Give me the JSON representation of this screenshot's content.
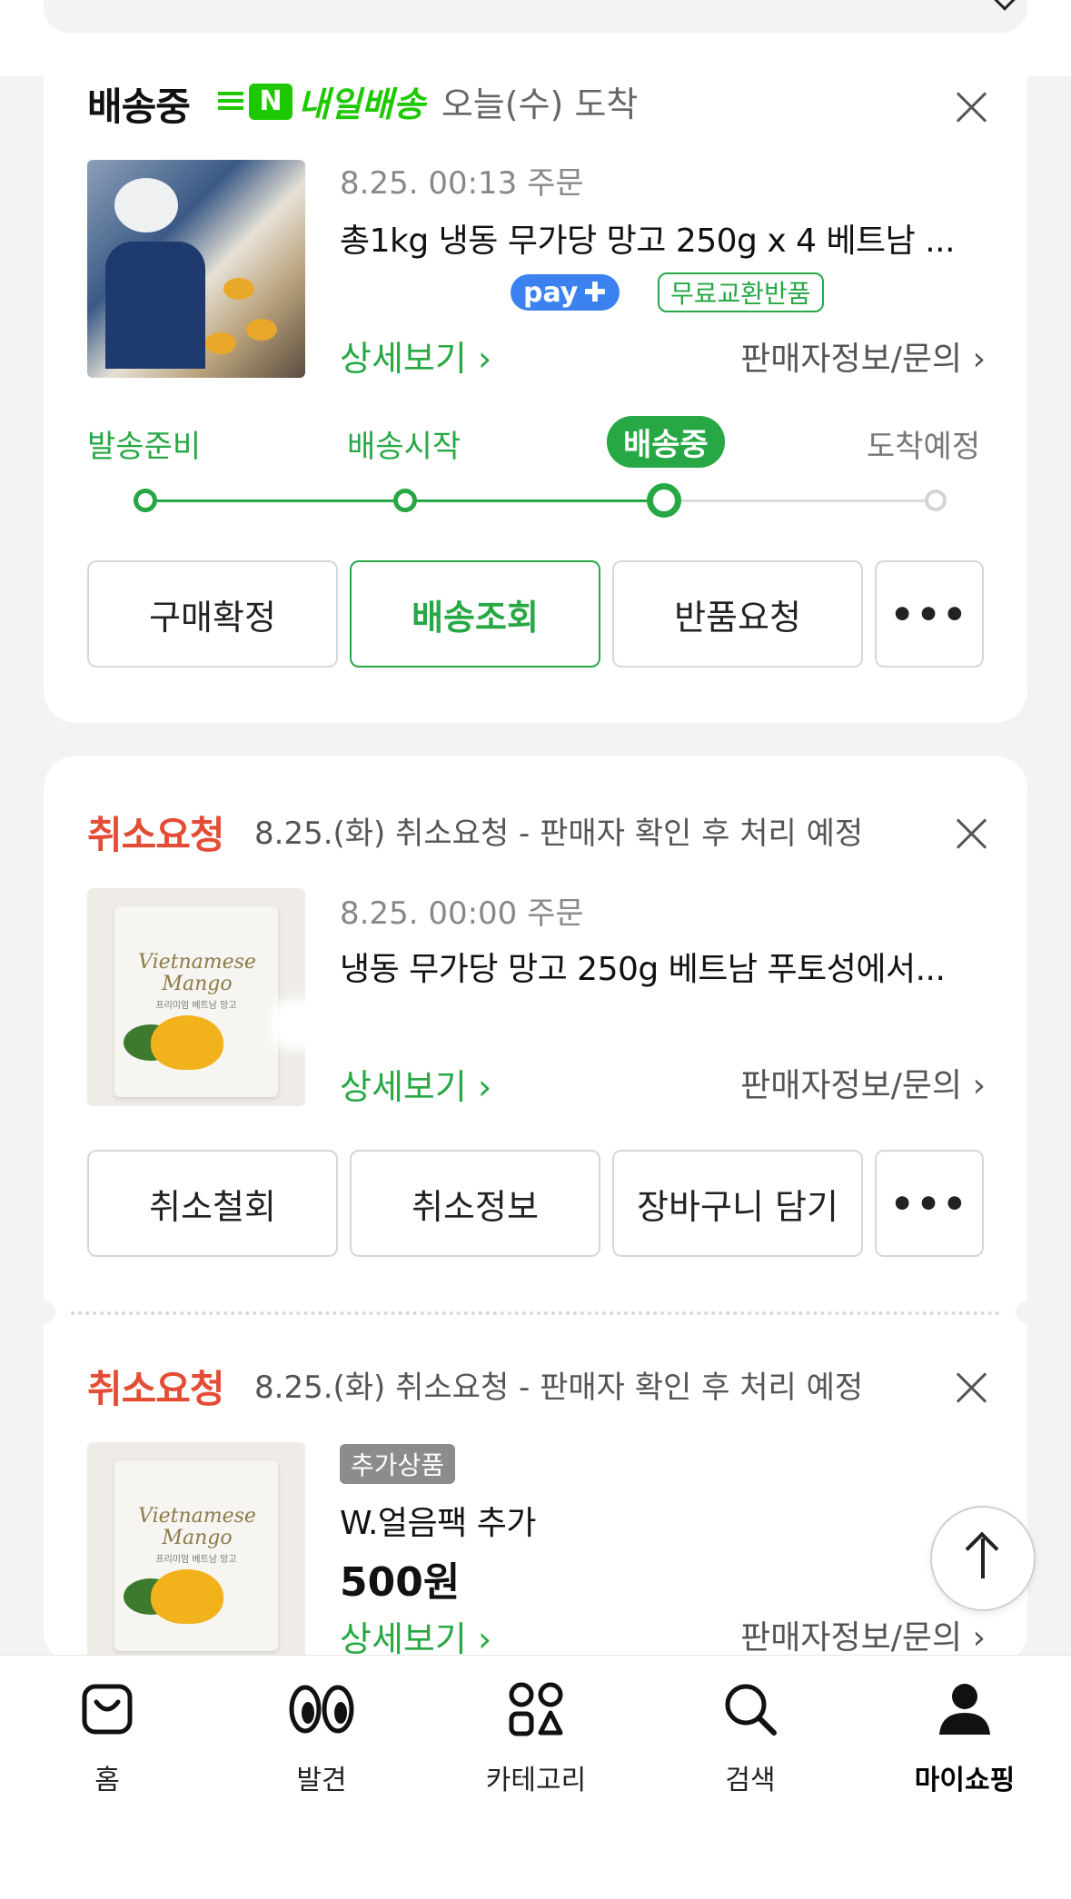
{
  "card1": {
    "status": "배송중",
    "delivery_badge_letter": "N",
    "delivery_name": "내일배송",
    "delivery_eta": "오늘(수) 도착",
    "order_time": "8.25. 00:13 주문",
    "product_name": "총1kg 냉동 무가당 망고 250g x 4 베트남 ...",
    "pay_label": "pay",
    "free_return": "무료교환반품",
    "detail_link": "상세보기",
    "seller_link": "판매자정보/문의",
    "steps": [
      "발송준비",
      "배송시작",
      "배송중",
      "도착예정"
    ],
    "current_step": 2,
    "buttons": [
      "구매확정",
      "배송조회",
      "반품요청",
      "•••"
    ]
  },
  "card2": {
    "status": "취소요청",
    "cancel_desc": "8.25.(화) 취소요청 - 판매자 확인 후 처리 예정",
    "order_time": "8.25. 00:00 주문",
    "product_name": "냉동 무가당 망고 250g 베트남 푸토성에서...",
    "detail_link": "상세보기",
    "seller_link": "판매자정보/문의",
    "buttons": [
      "취소철회",
      "취소정보",
      "장바구니 담기",
      "•••"
    ]
  },
  "card3": {
    "status": "취소요청",
    "cancel_desc": "8.25.(화) 취소요청 - 판매자 확인 후 처리 예정",
    "add_tag": "추가상품",
    "product_name": "W.얼음팩 추가",
    "price": "500원",
    "detail_link": "상세보기",
    "seller_link": "판매자정보/문의"
  },
  "product_image_text": {
    "brand_line1": "Vietnamese",
    "brand_line2": "Mango",
    "subtitle": "프리미엄 베트남 망고"
  },
  "colors": {
    "green": "#27a844",
    "naver_green": "#1ec800",
    "red": "#e34d35",
    "pay_blue": "#3b82f0"
  },
  "bottom_nav": [
    {
      "label": "홈",
      "icon": "home-bag-icon"
    },
    {
      "label": "발견",
      "icon": "eyes-icon"
    },
    {
      "label": "카테고리",
      "icon": "category-icon"
    },
    {
      "label": "검색",
      "icon": "search-icon"
    },
    {
      "label": "마이쇼핑",
      "icon": "user-icon",
      "active": true
    }
  ]
}
